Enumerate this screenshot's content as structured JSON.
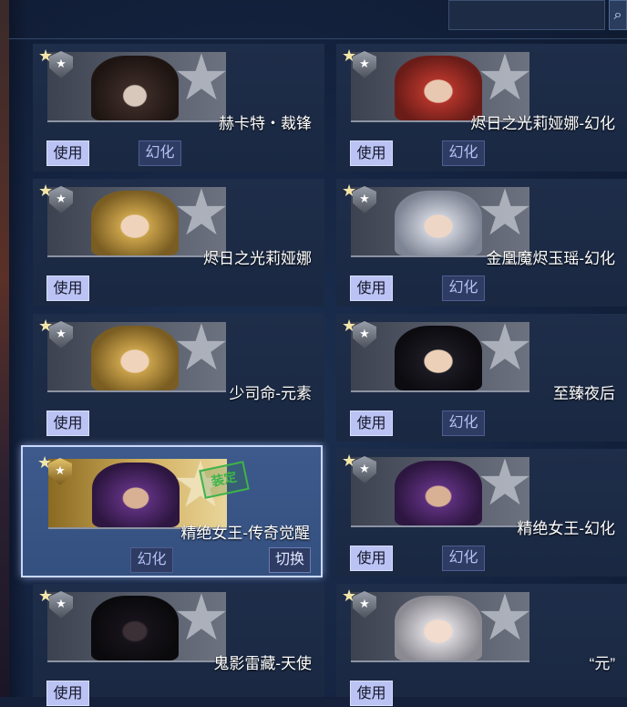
{
  "search": {
    "placeholder": "",
    "button_icon": "search-icon"
  },
  "buttons": {
    "use": "使用",
    "transform": "幻化",
    "switch": "切换"
  },
  "stamp_text": "装定",
  "cards": [
    {
      "name": "赫卡特・裁锋",
      "portrait": "hat",
      "show_use": true,
      "show_transform": true
    },
    {
      "name": "烬日之光莉娅娜-幻化",
      "portrait": "red",
      "show_use": true,
      "show_transform": true
    },
    {
      "name": "烬日之光莉娅娜",
      "portrait": "blonde",
      "show_use": true,
      "show_transform": false
    },
    {
      "name": "金凰魔烬玉瑶-幻化",
      "portrait": "silver",
      "show_use": true,
      "show_transform": true
    },
    {
      "name": "少司命-元素",
      "portrait": "blonde",
      "show_use": true,
      "show_transform": false
    },
    {
      "name": "至臻夜后",
      "portrait": "dark",
      "show_use": true,
      "show_transform": true
    },
    {
      "name": "精绝女王-传奇觉醒",
      "portrait": "purple",
      "selected": true,
      "equipped": true,
      "show_use": false,
      "show_transform": true,
      "show_switch": true
    },
    {
      "name": "精绝女王-幻化",
      "portrait": "purple",
      "show_use": true,
      "show_transform": true
    },
    {
      "name": "鬼影雷藏-天使",
      "portrait": "armor",
      "show_use": true,
      "show_transform": false
    },
    {
      "name": "“元”",
      "portrait": "white",
      "show_use": true,
      "show_transform": false
    }
  ]
}
